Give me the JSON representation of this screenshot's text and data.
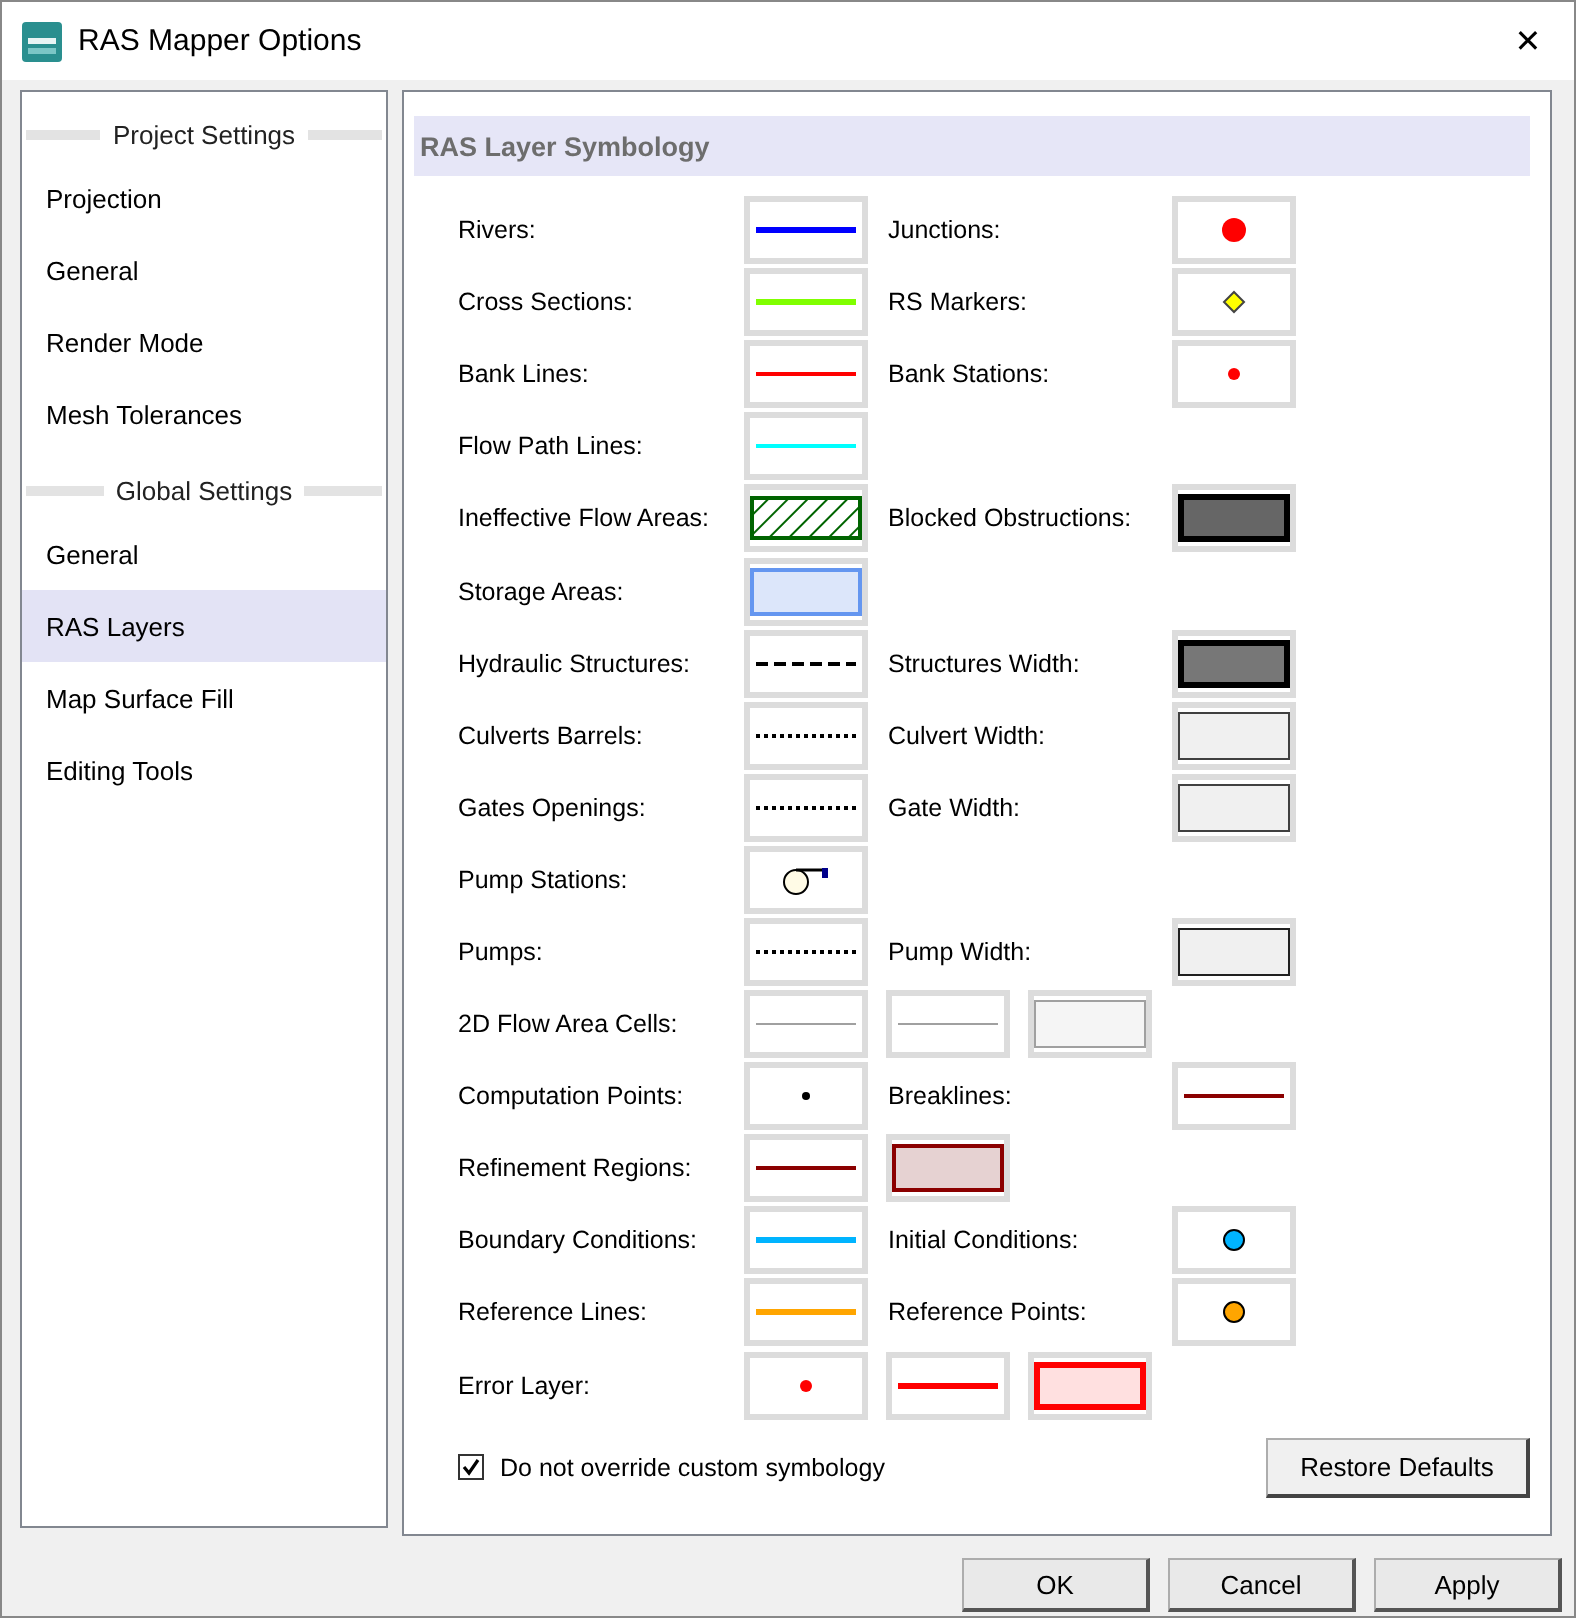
{
  "window": {
    "title": "RAS Mapper Options",
    "close": "✕"
  },
  "sidebar": {
    "sections": [
      {
        "title": "Project Settings",
        "items": [
          {
            "label": "Projection",
            "selected": false
          },
          {
            "label": "General",
            "selected": false
          },
          {
            "label": "Render Mode",
            "selected": false
          },
          {
            "label": "Mesh Tolerances",
            "selected": false
          }
        ]
      },
      {
        "title": "Global Settings",
        "items": [
          {
            "label": "General",
            "selected": false
          },
          {
            "label": "RAS Layers",
            "selected": true
          },
          {
            "label": "Map Surface Fill",
            "selected": false
          },
          {
            "label": "Editing Tools",
            "selected": false
          }
        ]
      }
    ]
  },
  "panel": {
    "title": "RAS Layer Symbology",
    "rows": [
      {
        "label": "Rivers:",
        "symbols": [
          {
            "kind": "thickline",
            "color": "#0000ff"
          }
        ],
        "right_label": "Junctions:",
        "right_symbols": [
          {
            "kind": "bigdot",
            "color": "#ff0000"
          }
        ]
      },
      {
        "label": "Cross Sections:",
        "symbols": [
          {
            "kind": "thickline",
            "color": "#80ff00"
          }
        ],
        "right_label": "RS Markers:",
        "right_symbols": [
          {
            "kind": "diamond",
            "color": "#ffff00"
          }
        ]
      },
      {
        "label": "Bank Lines:",
        "symbols": [
          {
            "kind": "line",
            "color": "#ff0000"
          }
        ],
        "right_label": "Bank Stations:",
        "right_symbols": [
          {
            "kind": "dot",
            "color": "#ff0000"
          }
        ]
      },
      {
        "label": "Flow Path Lines:",
        "symbols": [
          {
            "kind": "line",
            "color": "#00ffff"
          }
        ]
      },
      {
        "label": "Ineffective Flow Areas:",
        "symbols": [
          {
            "kind": "hatch",
            "color": "#006400"
          }
        ],
        "right_label": "Blocked Obstructions:",
        "right_symbols": [
          {
            "kind": "boldrect",
            "color": "#666666",
            "outline": {
              "color": "#000000"
            }
          }
        ]
      },
      {
        "label": "Storage Areas:",
        "symbols": [
          {
            "kind": "rect",
            "color": "#dce6fa",
            "outline": {
              "color": "#6496f0"
            }
          }
        ]
      },
      {
        "label": "Hydraulic Structures:",
        "symbols": [
          {
            "kind": "dashline",
            "color": "#000000"
          }
        ],
        "right_label": "Structures Width:",
        "right_symbols": [
          {
            "kind": "boldrect",
            "color": "#777777",
            "outline": {
              "color": "#000000"
            }
          }
        ]
      },
      {
        "label": "Culverts Barrels:",
        "symbols": [
          {
            "kind": "dotline",
            "color": "#000000"
          }
        ],
        "right_label": "Culvert Width:",
        "right_symbols": [
          {
            "kind": "thinrect",
            "color": "#f0f0f0",
            "outline": {
              "color": "#404040"
            }
          }
        ]
      },
      {
        "label": "Gates Openings:",
        "symbols": [
          {
            "kind": "dotline",
            "color": "#000000"
          }
        ],
        "right_label": "Gate Width:",
        "right_symbols": [
          {
            "kind": "thinrect",
            "color": "#f0f0f0",
            "outline": {
              "color": "#404040"
            }
          }
        ]
      },
      {
        "label": "Pump Stations:",
        "symbols": [
          {
            "kind": "pump"
          }
        ]
      },
      {
        "label": "Pumps:",
        "symbols": [
          {
            "kind": "dotline",
            "color": "#000000"
          }
        ],
        "right_label": "Pump Width:",
        "right_symbols": [
          {
            "kind": "thinrect",
            "color": "#f0f0f0",
            "outline": {
              "color": "#202020"
            }
          }
        ]
      },
      {
        "label": "2D Flow Area Cells:",
        "symbols": [
          {
            "kind": "thinline",
            "color": "#a0a0a0"
          },
          {
            "kind": "thinline",
            "color": "#a0a0a0"
          },
          {
            "kind": "thinrect",
            "color": "#f5f5f5",
            "outline": {
              "color": "#a0a0a0"
            }
          }
        ]
      },
      {
        "label": "Computation Points:",
        "symbols": [
          {
            "kind": "smalldot",
            "color": "#000000"
          }
        ],
        "right_label": "Breaklines:",
        "right_symbols": [
          {
            "kind": "line",
            "color": "#8b0000"
          }
        ]
      },
      {
        "label": "Refinement Regions:",
        "symbols": [
          {
            "kind": "line",
            "color": "#8b0000"
          },
          {
            "kind": "rect",
            "color": "#e6d2d2",
            "outline": {
              "color": "#8b0000"
            }
          }
        ]
      },
      {
        "label": "Boundary Conditions:",
        "symbols": [
          {
            "kind": "thickline",
            "color": "#00b4ff"
          }
        ],
        "right_label": "Initial Conditions:",
        "right_symbols": [
          {
            "kind": "ringdot",
            "color": "#00b4ff"
          }
        ]
      },
      {
        "label": "Reference Lines:",
        "symbols": [
          {
            "kind": "thickline",
            "color": "#ffa500"
          }
        ],
        "right_label": "Reference Points:",
        "right_symbols": [
          {
            "kind": "ringdot",
            "color": "#ffa500"
          }
        ]
      },
      {
        "label": "Error Layer:",
        "symbols": [
          {
            "kind": "dot",
            "color": "#ff0000"
          },
          {
            "kind": "thickline",
            "color": "#ff0000"
          },
          {
            "kind": "boldrect",
            "color": "#ffe0e0",
            "outline": {
              "color": "#ff0000"
            }
          }
        ]
      }
    ],
    "override": {
      "label": "Do not override custom symbology",
      "checked": true
    },
    "restore_button": "Restore Defaults"
  },
  "buttons": [
    "OK",
    "Cancel",
    "Apply"
  ]
}
